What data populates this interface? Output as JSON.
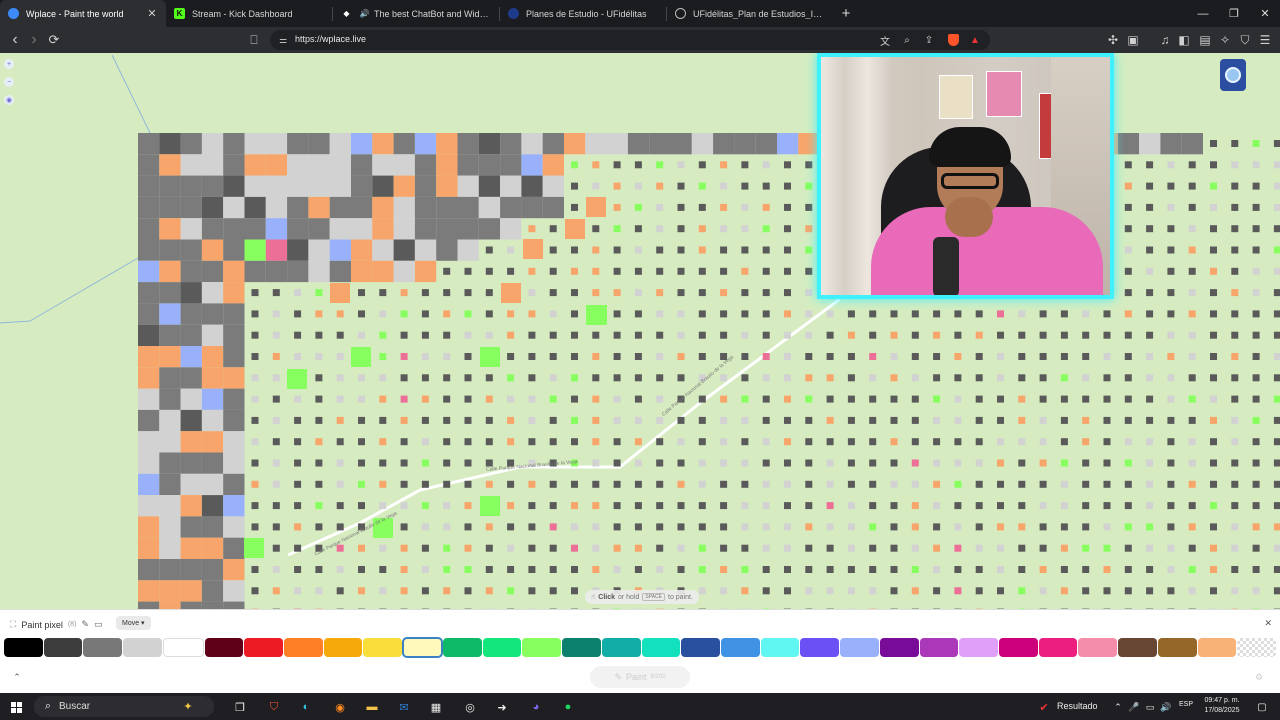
{
  "tabs": [
    {
      "title": "Wplace - Paint the world",
      "icon": "wplace-favicon",
      "color": "#3d8bf7",
      "active": true,
      "close": "✕"
    },
    {
      "title": "Stream - Kick Dashboard",
      "icon": "kick-favicon",
      "color": "#53fc18",
      "active": false
    },
    {
      "title": "The best ChatBot and Widgets fo",
      "icon": "streamelements-favicon",
      "color": "#ffffff",
      "active": false
    },
    {
      "title": "Planes de Estudio - UFidélitas",
      "icon": "ufidelitas-favicon",
      "color": "#1e3a8a",
      "active": false
    },
    {
      "title": "UFidélitas_Plan de Estudios_Ing Siste",
      "icon": "globe-favicon",
      "color": "#999999",
      "active": false
    }
  ],
  "newtab": "+",
  "window_controls": {
    "minimize": "—",
    "maximize": "❐",
    "close": "✕"
  },
  "toolbar": {
    "back": "‹",
    "forward": "›",
    "reload": "⟳",
    "bookmark": "⎕",
    "url": "https://wplace.live",
    "site_info": "⚌"
  },
  "page": {
    "side_tools": [
      "+",
      "−",
      "◉"
    ],
    "road_labels": [
      "Calle Parque Nacional Braulio de la Vega",
      "Calle Parque Nacional Braulio de la Vega",
      "Calle Parque Nacional Braulio de la Vega"
    ],
    "hint": {
      "bold": "Click",
      "middle": "or hold",
      "key": "SPACE",
      "end": "to paint."
    }
  },
  "panel": {
    "title": "Paint pixel",
    "count": "(8)",
    "move_label": "Move ▾",
    "close": "✕",
    "paint_label": "Paint",
    "paint_count": "8/200",
    "expand": "⌃",
    "settings": "⚙",
    "palette": [
      "#000000",
      "#3c3c3c",
      "#787878",
      "#d2d2d2",
      "#ffffff",
      "#600018",
      "#ed1c24",
      "#ff7f27",
      "#f6aa09",
      "#f9dd3b",
      "#fffabc",
      "#0eb968",
      "#13e67b",
      "#87ff5e",
      "#0c816e",
      "#10aea6",
      "#13e1be",
      "#28509e",
      "#4093e4",
      "#60f7f2",
      "#6b50f6",
      "#99b1fb",
      "#780c99",
      "#aa38b9",
      "#e09ff9",
      "#cb007a",
      "#ec1f80",
      "#f38da9",
      "#684634",
      "#95682a",
      "#f8b277",
      "transparent"
    ],
    "selected_index": 10
  },
  "taskbar": {
    "search_placeholder": "Buscar",
    "tray_label": "Resultado",
    "lang": "ESP",
    "time": "09:47 p. m.",
    "date": "17/08/2025"
  },
  "colors": {
    "map_bg": "#d6ecc0",
    "pixel_dark": "#5a5a5a",
    "pixel_gray": "#7b7b7b",
    "pixel_light": "#d2d2d2",
    "pixel_orange": "#f7a56b",
    "pixel_green": "#87ff5e",
    "pixel_blue": "#99b1fb",
    "pixel_pink": "#ec6f98",
    "webcam_border": "#3ff0ff"
  }
}
